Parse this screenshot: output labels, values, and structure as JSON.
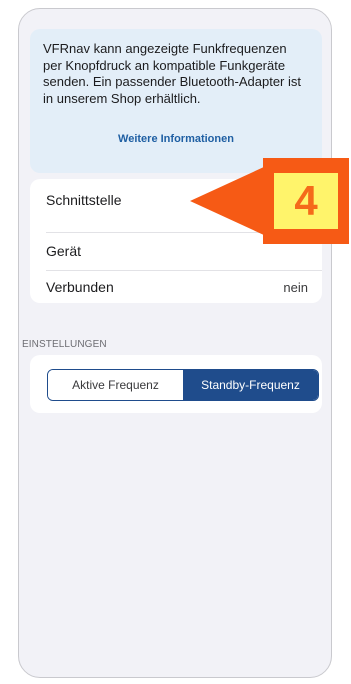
{
  "info": {
    "text": "VFRnav kann angezeigte Funkfrequenzen per Knopfdruck an kompatible Funkgeräte senden. Ein passender Bluetooth-Adapter ist in unserem Shop erhältlich.",
    "link": "Weitere Informationen"
  },
  "device_list": {
    "rows": [
      {
        "label": "Schnittstelle",
        "value": ""
      },
      {
        "label": "Gerät",
        "value": ""
      },
      {
        "label": "Verbunden",
        "value": "nein"
      }
    ]
  },
  "settings": {
    "header": "EINSTELLUNGEN",
    "segments": [
      {
        "label": "Aktive Frequenz",
        "selected": false
      },
      {
        "label": "Standby-Frequenz",
        "selected": true
      }
    ]
  },
  "callout": {
    "number": "4",
    "colors": {
      "arrow": "#f65a15",
      "badge_fill": "#fff46b"
    }
  },
  "colors": {
    "accent": "#1f4c8c",
    "link": "#1f5fa3",
    "info_background": "#e3eef8",
    "page_background": "#f2f2f7"
  }
}
